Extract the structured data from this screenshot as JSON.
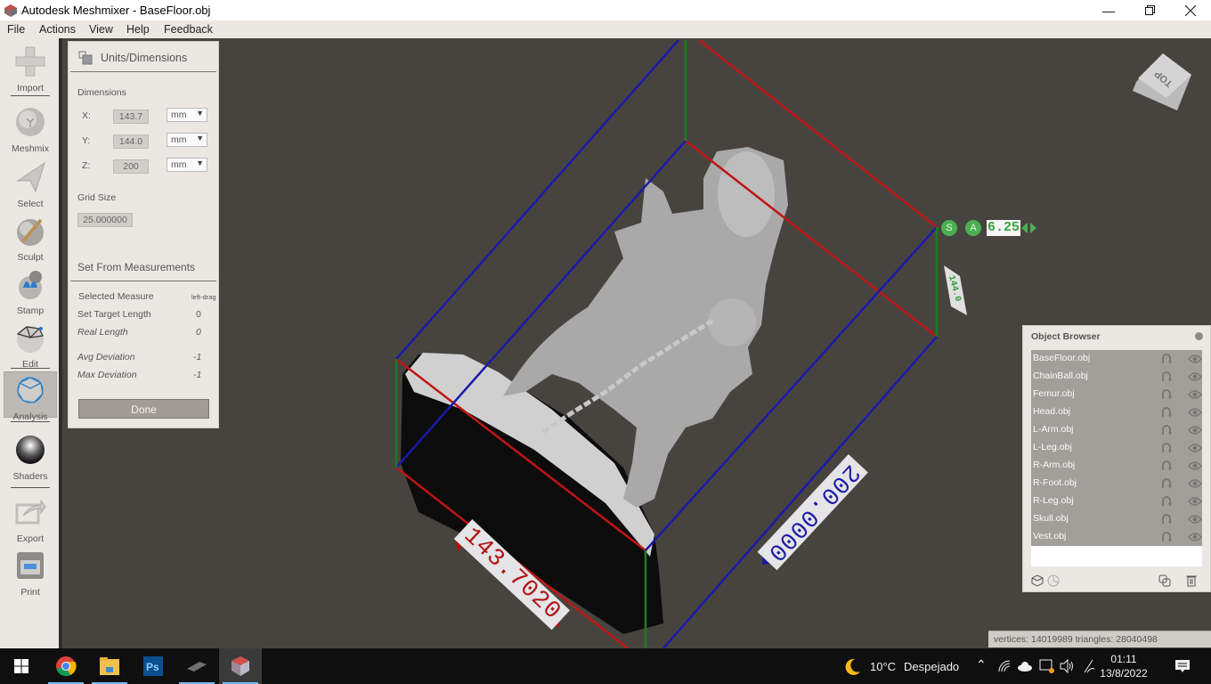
{
  "window": {
    "title": "Autodesk Meshmixer - BaseFloor.obj",
    "minimize_icon": "minimize-icon",
    "restore_icon": "restore-icon",
    "close_icon": "close-icon"
  },
  "menu": [
    "File",
    "Actions",
    "View",
    "Help",
    "Feedback"
  ],
  "toolbar": [
    {
      "label": "Import",
      "icon": "plus-icon"
    },
    {
      "label": "Meshmix",
      "icon": "meshmix-head-icon"
    },
    {
      "label": "Select",
      "icon": "arrow-cursor-icon"
    },
    {
      "label": "Sculpt",
      "icon": "brush-sphere-icon"
    },
    {
      "label": "Stamp",
      "icon": "fleur-de-lis-stamp-icon"
    },
    {
      "label": "Edit",
      "icon": "wireframe-sphere-icon"
    },
    {
      "label": "Analysis",
      "icon": "mesh-sphere-icon",
      "active": true
    },
    {
      "label": "Shaders",
      "icon": "chrome-sphere-icon"
    },
    {
      "label": "Export",
      "icon": "export-arrow-icon"
    },
    {
      "label": "Print",
      "icon": "printer-icon"
    }
  ],
  "panel": {
    "title": "Units/Dimensions",
    "dimensions_label": "Dimensions",
    "dims": [
      {
        "axis": "X:",
        "value": "143.7",
        "unit": "mm"
      },
      {
        "axis": "Y:",
        "value": "144.0",
        "unit": "mm"
      },
      {
        "axis": "Z:",
        "value": "200",
        "unit": "mm"
      }
    ],
    "grid_size_label": "Grid Size",
    "grid_size_value": "25.000000",
    "measure_section_title": "Set From Measurements",
    "selected_measure_label": "Selected Measure",
    "selected_measure_value": "left-drag",
    "target_length_label": "Set Target Length",
    "target_length_value": "0",
    "real_length_label": "Real Length",
    "real_length_value": "0",
    "avg_dev_label": "Avg Deviation",
    "avg_dev_value": "-1",
    "max_dev_label": "Max Deviation",
    "max_dev_value": "-1",
    "done_label": "Done"
  },
  "viewport": {
    "navcube_label": "TOP",
    "measure_x": "143.7020",
    "measure_y": "200.0000",
    "gizmo_s": "S",
    "gizmo_a": "A",
    "gizmo_value": "6.25",
    "colors": {
      "x_axis": "#c01515",
      "y_axis": "#1a1aa8",
      "z_axis": "#1f7a1f",
      "background": "#474440"
    }
  },
  "object_browser": {
    "title": "Object Browser",
    "objects": [
      "BaseFloor.obj",
      "ChainBall.obj",
      "Femur.obj",
      "Head.obj",
      "L-Arm.obj",
      "L-Leg.obj",
      "R-Arm.obj",
      "R-Foot.obj",
      "R-Leg.obj",
      "Skull.obj",
      "Vest.obj"
    ]
  },
  "status": {
    "text": "vertices: 14019989 triangles: 28040498"
  },
  "taskbar": {
    "apps": [
      "start-icon",
      "chrome-icon",
      "file-explorer-icon",
      "photoshop-icon",
      "hdd-app-icon",
      "meshmixer-icon"
    ],
    "weather_temp": "10°C",
    "weather_desc": "Despejado",
    "time": "01:11",
    "date": "13/8/2022"
  }
}
